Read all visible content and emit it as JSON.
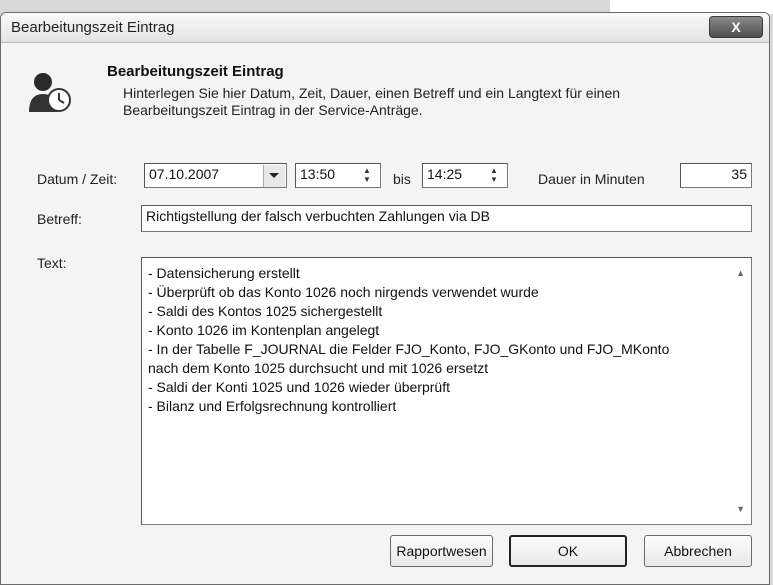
{
  "window": {
    "title": "Bearbeitungszeit Eintrag",
    "close_glyph": "X"
  },
  "header": {
    "icon": "user-clock-icon",
    "title": "Bearbeitungszeit Eintrag",
    "description": "Hinterlegen Sie hier Datum, Zeit, Dauer, einen Betreff und ein Langtext für einen Bearbeitungszeit Eintrag in der Service-Anträge."
  },
  "form": {
    "datum_label": "Datum / Zeit:",
    "date_value": "07.10.2007",
    "time_from": "13:50",
    "bis_label": "bis",
    "time_to": "14:25",
    "dauer_label": "Dauer in Minuten",
    "dauer_value": "35",
    "betreff_label": "Betreff:",
    "betreff_value": "Richtigstellung der falsch verbuchten Zahlungen via DB",
    "text_label": "Text:",
    "text_lines": [
      "- Datensicherung erstellt",
      "- Überprüft ob das Konto 1026 noch nirgends verwendet wurde",
      "- Saldi des Kontos 1025 sichergestellt",
      "- Konto 1026 im Kontenplan angelegt",
      "- In der Tabelle F_JOURNAL die Felder FJO_Konto, FJO_GKonto und FJO_MKonto",
      "nach dem Konto 1025 durchsucht und mit 1026 ersetzt",
      "- Saldi der Konti 1025 und 1026 wieder überprüft",
      "- Bilanz und Erfolgsrechnung kontrolliert"
    ]
  },
  "buttons": {
    "rapportwesen": "Rapportwesen",
    "ok": "OK",
    "abbrechen": "Abbrechen"
  }
}
